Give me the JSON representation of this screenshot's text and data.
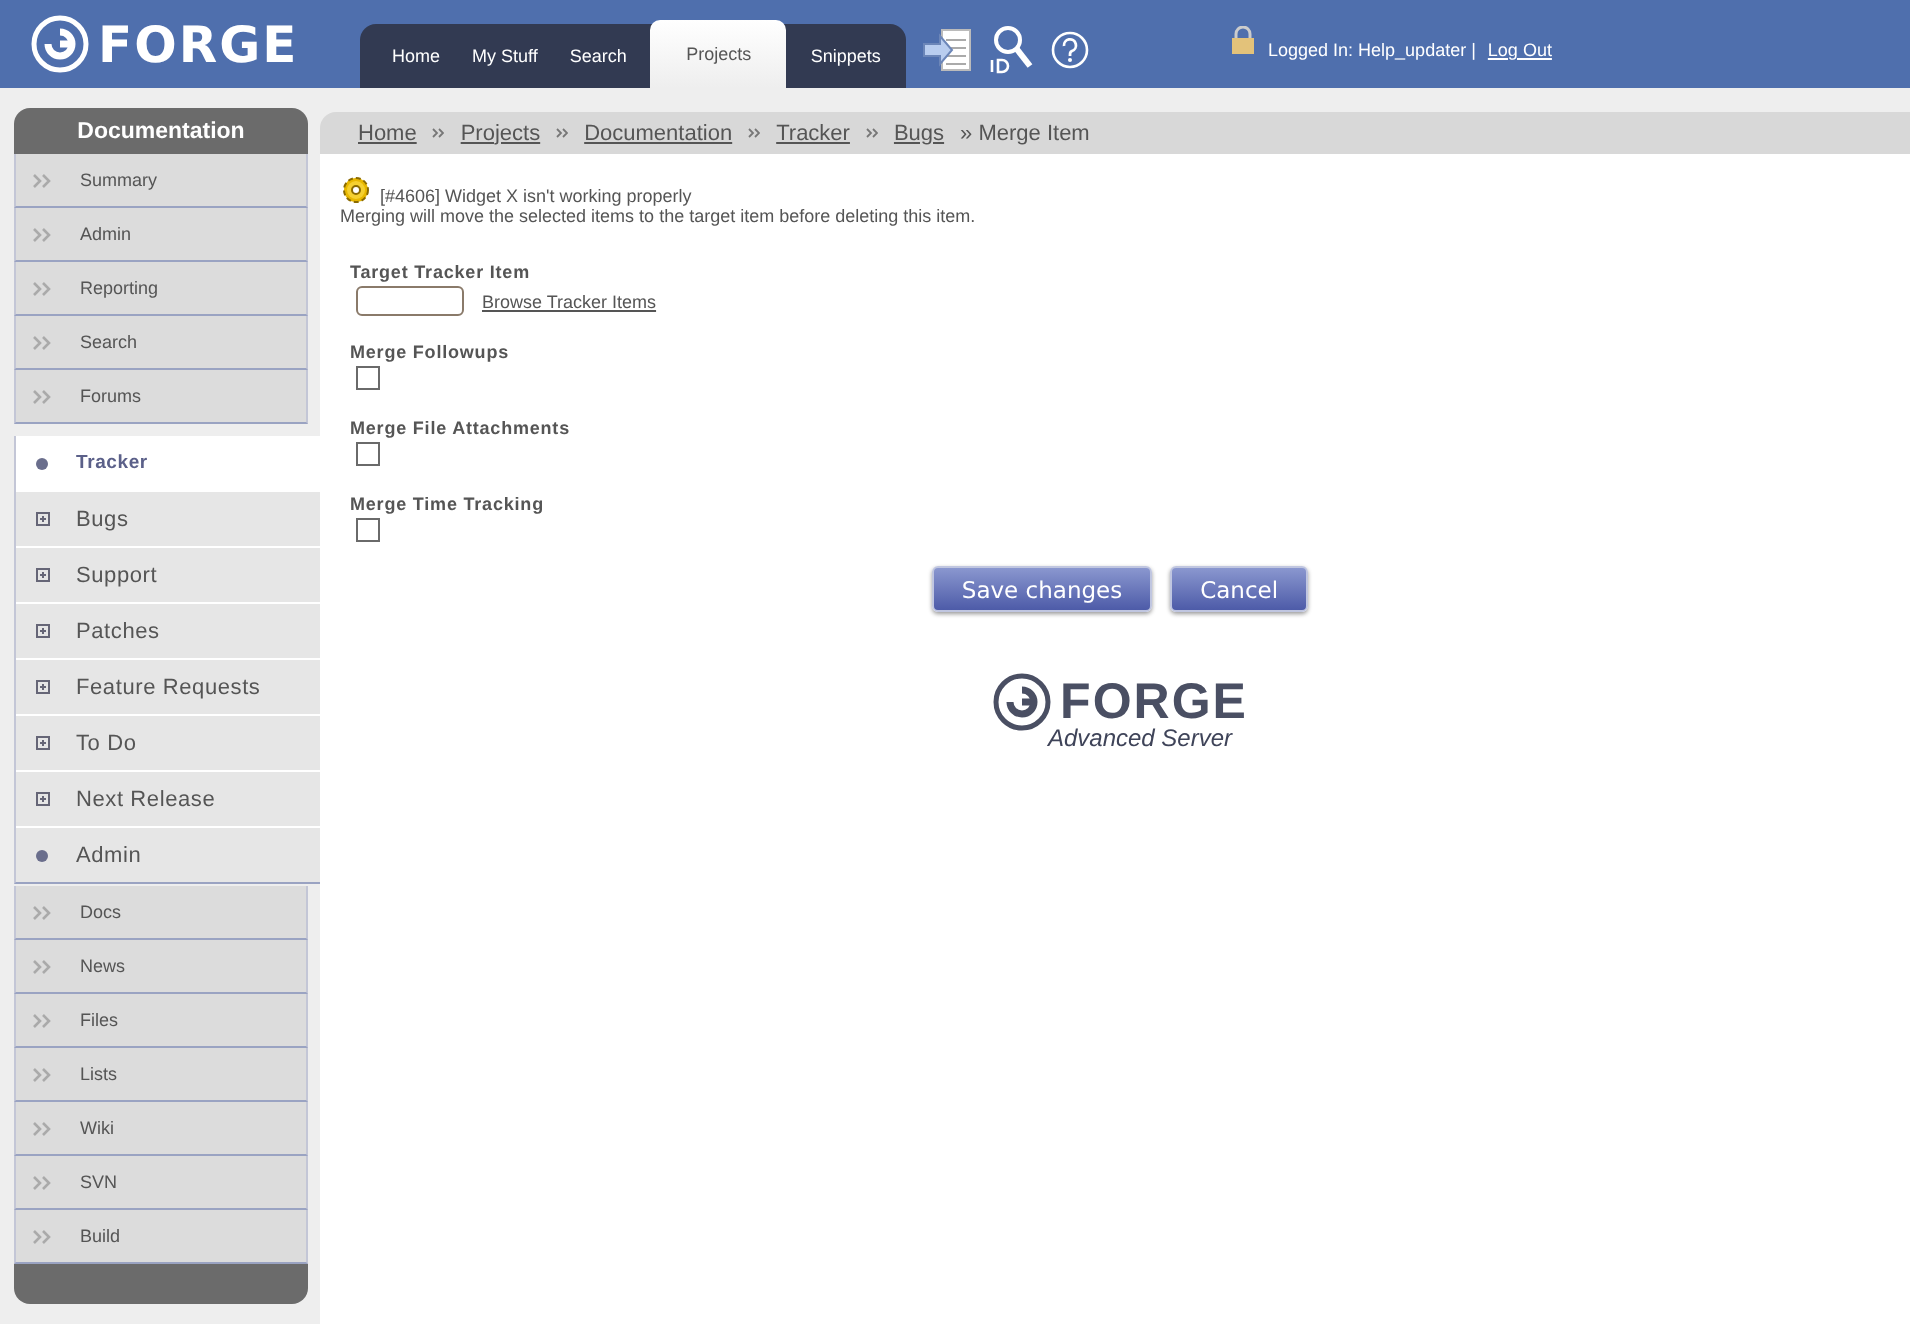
{
  "header": {
    "logo": "FORGE",
    "tabs": [
      {
        "label": "Home",
        "selected": false
      },
      {
        "label": "My Stuff",
        "selected": false
      },
      {
        "label": "Search",
        "selected": false
      },
      {
        "label": "Projects",
        "selected": true
      },
      {
        "label": "Snippets",
        "selected": false
      }
    ],
    "login": "Logged In: Help_updater |",
    "logout": "Log Out"
  },
  "sidebar": {
    "title": "Documentation",
    "items": [
      {
        "label": "Summary"
      },
      {
        "label": "Admin"
      },
      {
        "label": "Reporting"
      },
      {
        "label": "Search"
      },
      {
        "label": "Forums"
      }
    ],
    "tracker": [
      {
        "label": "Tracker",
        "kind": "dot",
        "selected": true
      },
      {
        "label": "Bugs",
        "kind": "expand",
        "selected": false
      },
      {
        "label": "Support",
        "kind": "expand",
        "selected": false
      },
      {
        "label": "Patches",
        "kind": "expand",
        "selected": false
      },
      {
        "label": "Feature Requests",
        "kind": "expand",
        "selected": false
      },
      {
        "label": "To Do",
        "kind": "expand",
        "selected": false
      },
      {
        "label": "Next Release",
        "kind": "expand",
        "selected": false
      },
      {
        "label": "Admin",
        "kind": "dot",
        "selected": false
      }
    ],
    "more": [
      {
        "label": "Docs"
      },
      {
        "label": "News"
      },
      {
        "label": "Files"
      },
      {
        "label": "Lists"
      },
      {
        "label": "Wiki"
      },
      {
        "label": "SVN"
      },
      {
        "label": "Build"
      }
    ]
  },
  "breadcrumb": {
    "links": [
      "Home",
      "Projects",
      "Documentation",
      "Tracker",
      "Bugs"
    ],
    "current": "» Merge Item"
  },
  "item": {
    "title": "[#4606] Widget X isn't working properly",
    "note": "Merging will move the selected items to the target item before deleting this item."
  },
  "form": {
    "target_label": "Target Tracker Item",
    "browse": "Browse Tracker Items",
    "options": [
      {
        "label": "Merge Followups",
        "checked": false
      },
      {
        "label": "Merge File Attachments",
        "checked": false
      },
      {
        "label": "Merge Time Tracking",
        "checked": false
      }
    ],
    "buttons": [
      "Save changes",
      "Cancel"
    ]
  },
  "footer": {
    "logo": "FORGE",
    "tagline": "Advanced Server"
  }
}
